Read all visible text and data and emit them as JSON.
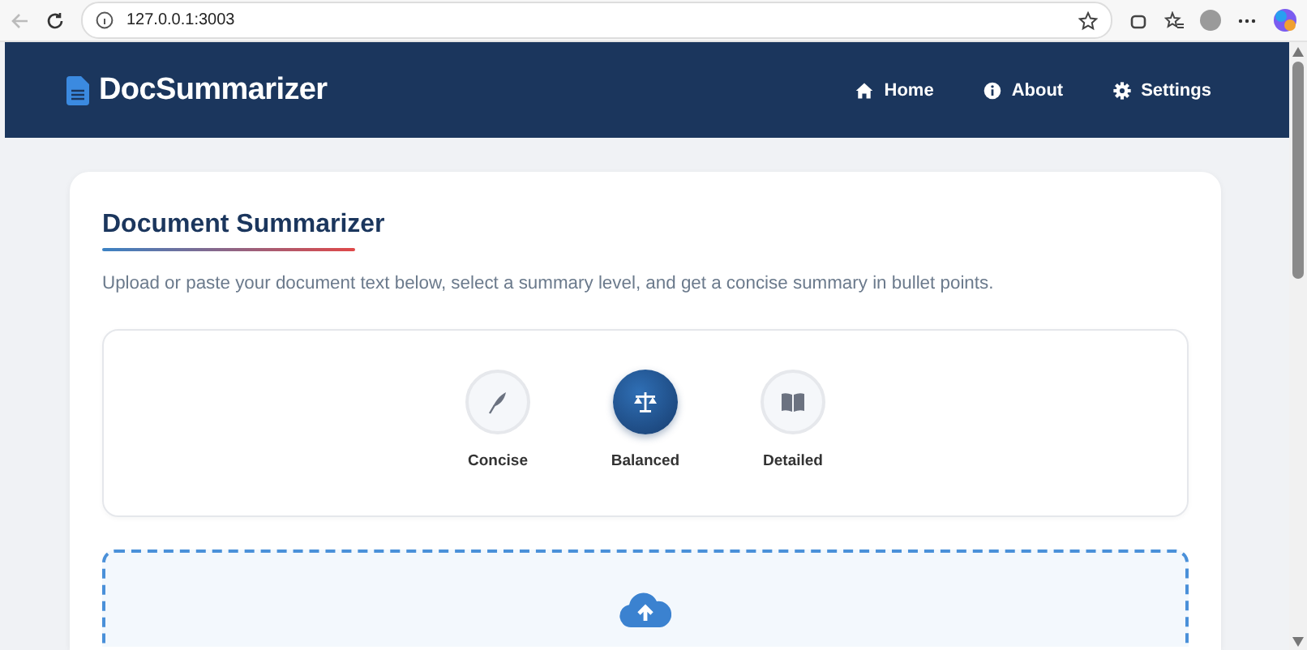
{
  "browser": {
    "address": "127.0.0.1:3003"
  },
  "header": {
    "brand": "DocSummarizer",
    "nav": [
      {
        "kind": "home",
        "label": "Home"
      },
      {
        "kind": "info",
        "label": "About"
      },
      {
        "kind": "gear",
        "label": "Settings"
      }
    ]
  },
  "card": {
    "title": "Document Summarizer",
    "description": "Upload or paste your document text below, select a summary level, and get a concise summary in bullet points.",
    "levels": [
      {
        "kind": "feather",
        "label": "Concise",
        "selected": false
      },
      {
        "kind": "scale",
        "label": "Balanced",
        "selected": true
      },
      {
        "kind": "book",
        "label": "Detailed",
        "selected": false
      }
    ]
  }
}
